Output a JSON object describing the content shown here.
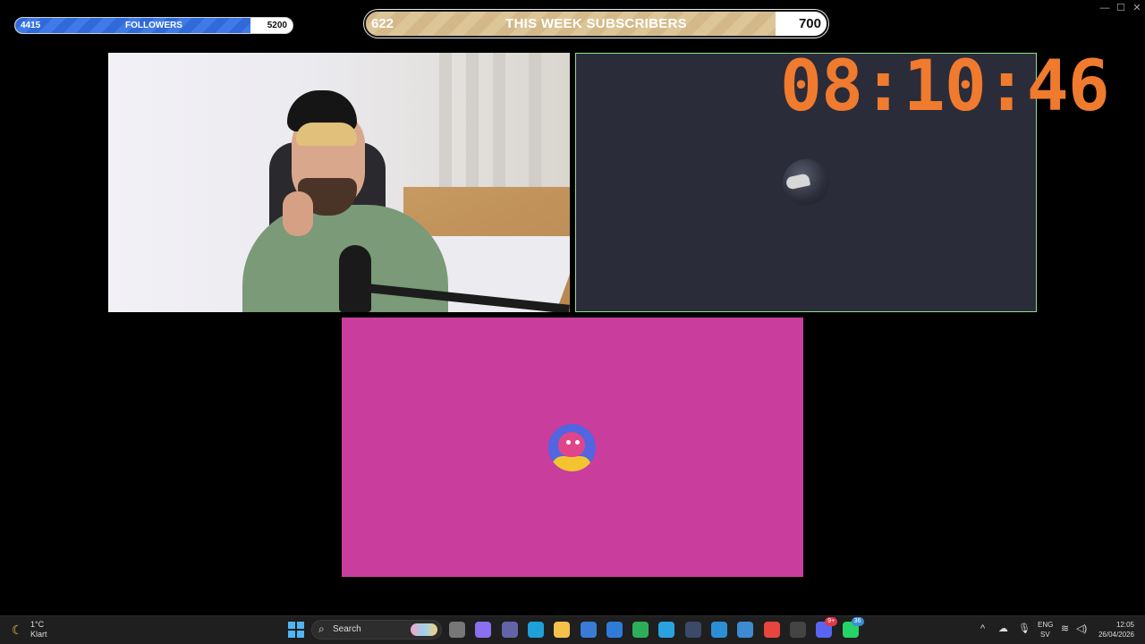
{
  "window_controls": {
    "minimize": "—",
    "maximize": "☐",
    "close": "✕"
  },
  "followers_bar": {
    "current": "4415",
    "label": "FOLLOWERS",
    "goal": "5200",
    "progress": 0.848
  },
  "subscribers_bar": {
    "current": "622",
    "label": "THIS WEEK SUBSCRIBERS",
    "goal": "700",
    "progress": 0.889
  },
  "timer": {
    "value": "08:10:46",
    "color": "#f07a2e"
  },
  "panels": {
    "dark_border_color": "#8fe08a",
    "pink_color": "#c93d9c",
    "dark_color": "#2b2c3a"
  },
  "taskbar": {
    "weather": {
      "icon": "moon-icon",
      "temp": "1°C",
      "condition": "Klart"
    },
    "search": {
      "label": "Search"
    },
    "pinned": [
      {
        "name": "file-explorer-icon",
        "color": "#777777"
      },
      {
        "name": "copilot-icon",
        "color": "#8a6ff0"
      },
      {
        "name": "teams-icon",
        "color": "#6264a7"
      },
      {
        "name": "edge-icon",
        "color": "#1fa0d8"
      },
      {
        "name": "folder-icon",
        "color": "#f4c24a"
      },
      {
        "name": "store-icon",
        "color": "#3a7bd5"
      },
      {
        "name": "mail-icon",
        "color": "#2f7bd9"
      },
      {
        "name": "vpn-icon",
        "color": "#2fae5a"
      },
      {
        "name": "microsoft365-icon",
        "color": "#29a3e0"
      },
      {
        "name": "terminal-icon",
        "color": "#3b4a66"
      },
      {
        "name": "photos-icon",
        "color": "#2c8fd6"
      },
      {
        "name": "remote-desktop-icon",
        "color": "#3d8bd0"
      },
      {
        "name": "chrome-icon",
        "color": "#e8453c"
      },
      {
        "name": "obs-icon",
        "color": "#444444"
      },
      {
        "name": "discord-icon",
        "color": "#5865f2",
        "badge": "9+"
      },
      {
        "name": "whatsapp-icon",
        "color": "#25d366",
        "badge": "36"
      }
    ],
    "tray": {
      "chevron": "^",
      "lang_top": "ENG",
      "lang_bottom": "SV"
    },
    "clock": {
      "time": "12:05",
      "date": "26/04/2026"
    }
  }
}
